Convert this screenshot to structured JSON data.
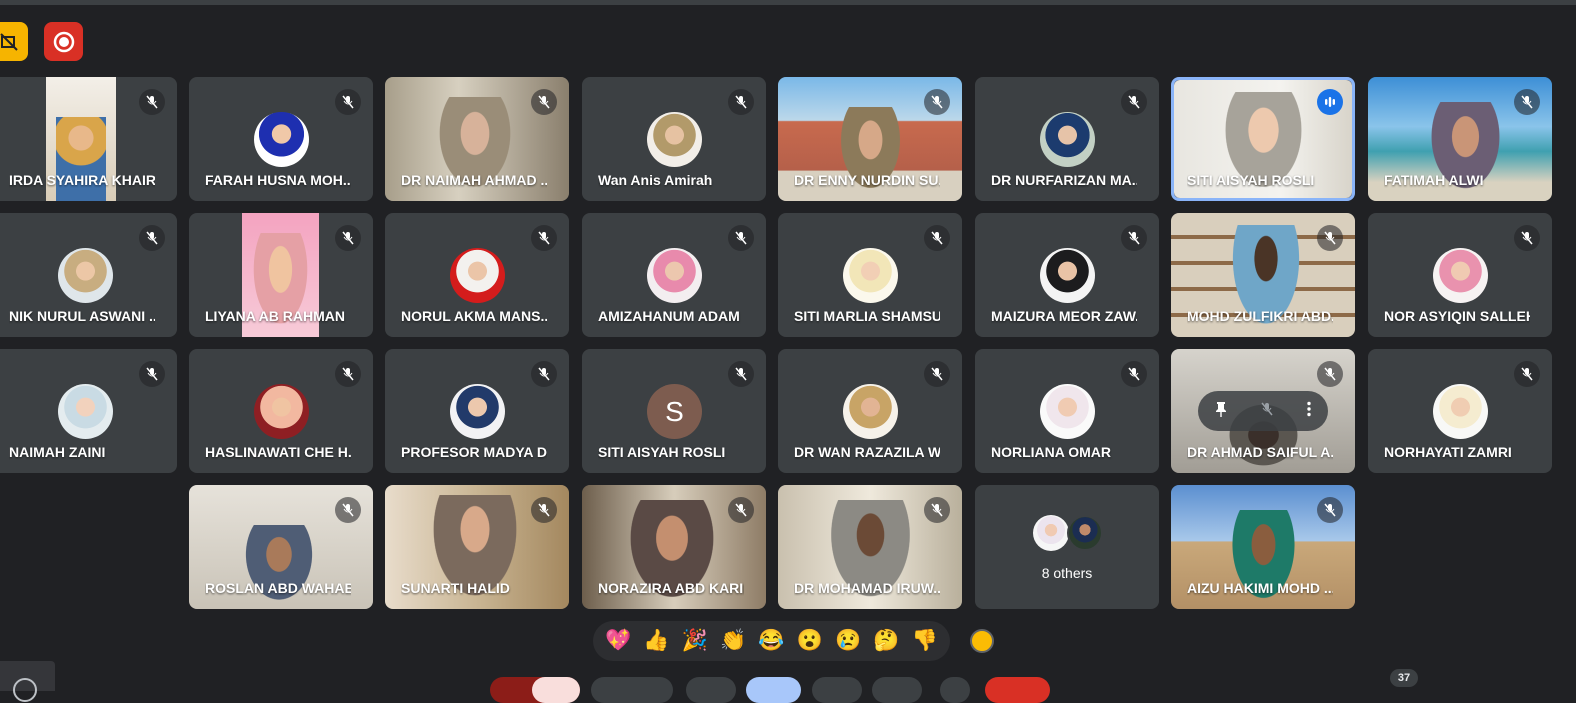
{
  "meeting": {
    "others_label": "8 others",
    "participant_count": "37",
    "reactions": [
      "💖",
      "👍",
      "🎉",
      "👏",
      "😂",
      "😮",
      "😢",
      "🤔",
      "👎"
    ]
  },
  "participants": [
    "IRDA SYAHIRA KHAIR ...",
    "FARAH HUSNA MOH...",
    "DR NAIMAH AHMAD ...",
    "Wan Anis Amirah",
    "DR ENNY NURDIN SU...",
    "DR NURFARIZAN MA...",
    "SITI AISYAH ROSLI",
    "FATIMAH ALWI",
    "NIK NURUL ASWANI ...",
    "LIYANA AB RAHMAN",
    "NORUL AKMA MANS...",
    "AMIZAHANUM ADAM",
    "SITI MARLIA SHAMSU...",
    "MAIZURA MEOR ZAW...",
    "MOHD ZULFIKRI ABD...",
    "NOR ASYIQIN SALLEH",
    "NAIMAH ZAINI",
    "HASLINAWATI CHE H...",
    "PROFESOR MADYA D...",
    "SITI AISYAH ROSLI",
    "DR WAN RAZAZILA W...",
    "NORLIANA OMAR",
    "DR AHMAD SAIFUL A...",
    "NORHAYATI ZAMRI",
    "ROSLAN ABD WAHAB",
    "SUNARTI HALID",
    "NORAZIRA ABD KARIM",
    "DR MOHAMAD IRUW...",
    "AIZU HAKIMI MOHD ..."
  ],
  "avatar_letter": "S",
  "icons": {
    "muted": "mic-off-icon",
    "speaking": "audio-wave-icon",
    "pin": "pin-icon",
    "more": "more-vert-icon"
  },
  "colors": {
    "background": "#202124",
    "tile": "#3c4043",
    "active_border": "#8ab4f8",
    "record": "#d93025",
    "warning": "#f6b400"
  }
}
